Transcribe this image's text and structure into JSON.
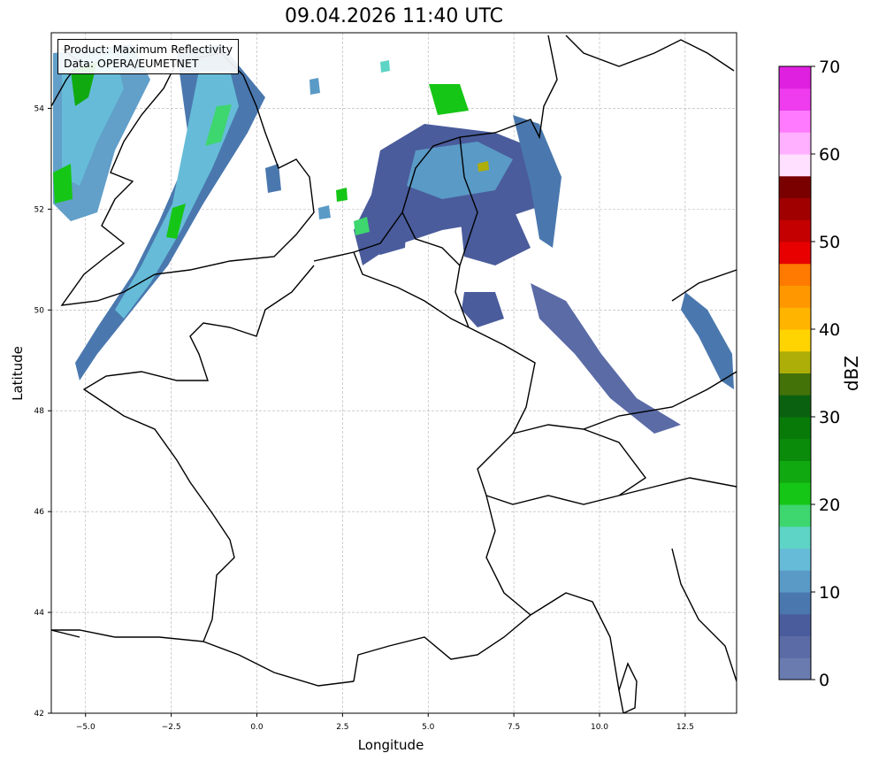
{
  "title": "09.04.2026 11:40 UTC",
  "info": {
    "product": "Product: Maximum Reflectivity",
    "source": "Data: OPERA/EUMETNET"
  },
  "axes": {
    "xlabel": "Longitude",
    "ylabel": "Latitude",
    "xlim": [
      -6,
      14
    ],
    "ylim": [
      42,
      55.5
    ],
    "xticks": [
      "−5.0",
      "−2.5",
      "0.0",
      "2.5",
      "5.0",
      "7.5",
      "10.0",
      "12.5"
    ],
    "xtick_values": [
      -5,
      -2.5,
      0,
      2.5,
      5,
      7.5,
      10,
      12.5
    ],
    "yticks": [
      "42",
      "44",
      "46",
      "48",
      "50",
      "52",
      "54"
    ],
    "ytick_values": [
      42,
      44,
      46,
      48,
      50,
      52,
      54
    ],
    "grid": true
  },
  "colorbar": {
    "label": "dBZ",
    "ticks": [
      "0",
      "10",
      "20",
      "30",
      "40",
      "50",
      "60",
      "70"
    ],
    "tick_values": [
      0,
      10,
      20,
      30,
      40,
      50,
      60,
      70
    ],
    "range": [
      0,
      70
    ],
    "step": 2.5,
    "colors": [
      "#6a7bb0",
      "#5a6ba6",
      "#4a5c9c",
      "#4a78ae",
      "#5a9ac6",
      "#66bcd8",
      "#5ed4c6",
      "#3ed66e",
      "#16c616",
      "#10aa10",
      "#0a8c0a",
      "#087a08",
      "#0a6210",
      "#427208",
      "#aeae08",
      "#ffd400",
      "#ffb400",
      "#ff9800",
      "#ff7a00",
      "#e80000",
      "#c40000",
      "#a00000",
      "#7a0000",
      "#ffe0ff",
      "#ffb0ff",
      "#ff7aff",
      "#ee3cee",
      "#e020e0"
    ]
  },
  "coastline_color": "#000000",
  "land_color": "#ffffff"
}
